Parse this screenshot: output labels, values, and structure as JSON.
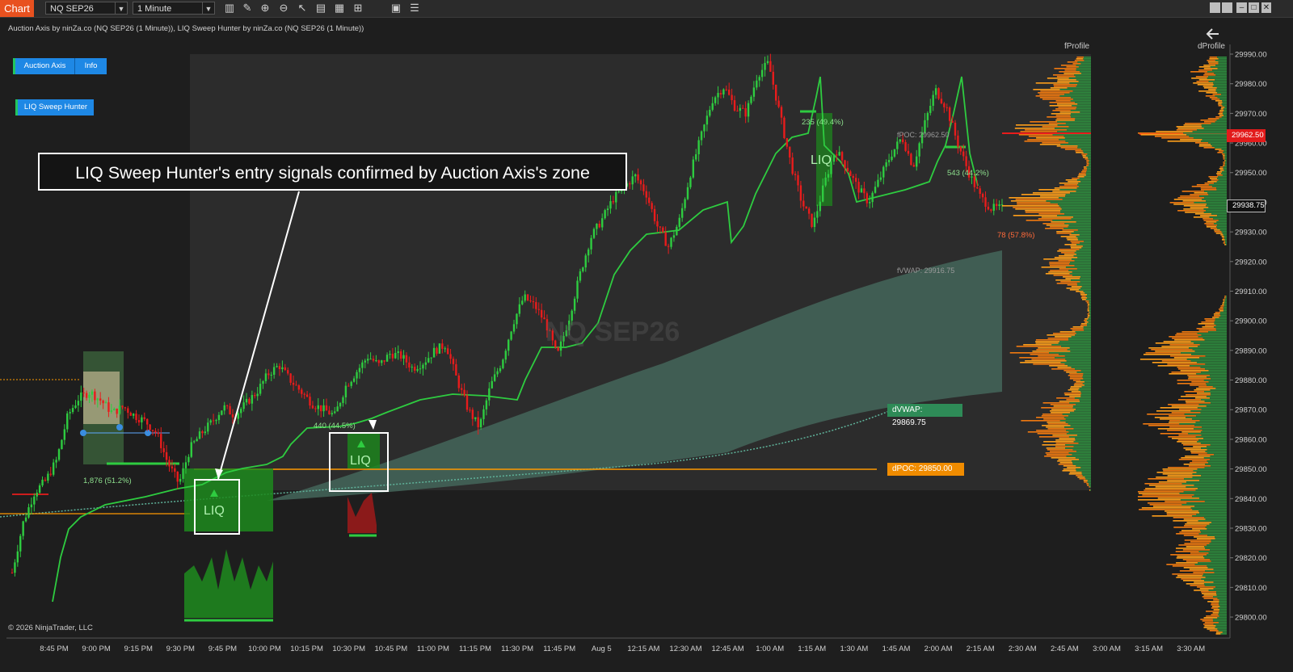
{
  "toolbar": {
    "tab_label": "Chart",
    "instrument": "NQ SEP26",
    "interval": "1 Minute",
    "icons": [
      "bar-type-icon",
      "draw-pencil-icon",
      "zoom-in-icon",
      "zoom-out-icon",
      "pointer-icon",
      "properties-icon",
      "templates-icon",
      "strategies-icon",
      "data-box-icon",
      "chart-trader-icon"
    ],
    "window_buttons": [
      "restore-icon",
      "maximize-icon",
      "minimize-icon",
      "tile-icon",
      "close-icon"
    ]
  },
  "indicator_title": "Auction Axis by ninZa.co (NQ SEP26 (1 Minute)), LIQ Sweep Hunter by ninZa.co (NQ SEP26 (1 Minute))",
  "panel_buttons": {
    "auction_axis": "Auction Axis",
    "info": "Info",
    "liq_sweep_hunter": "LIQ Sweep Hunter"
  },
  "profile_labels": {
    "fprofile": "fProfile",
    "dprofile": "dProfile"
  },
  "callout_text": "LIQ Sweep Hunter's entry signals confirmed by Auction Axis's zone",
  "watermark": "NQ SEP26",
  "copyright": "© 2026 NinjaTrader, LLC",
  "signals": {
    "liq_label": "LIQ"
  },
  "annotations": {
    "ann1": "1,876 (51.2%)",
    "ann2": "440 (44.5%)",
    "ann3": "235 (49.4%)",
    "ann4": "543 (44.2%)",
    "ann5": "78 (57.8%)",
    "fpoc": "fPOC: 29962.50",
    "fvwap": "fVWAP: 29916.75"
  },
  "tags": {
    "dvwap": "dVWAP: 29869.75",
    "dpoc": "dPOC: 29850.00",
    "price_red": "29962.50",
    "price_last": "29938.75"
  },
  "colors": {
    "bull": "#2ecc40",
    "bear": "#e81c1c",
    "vwap_band": "#4a6b5e",
    "dpoc_line": "#ff9900",
    "dvwap_tag": "#2e8b57",
    "dpoc_tag": "#f08c00",
    "profile_orange": "#ff9f1a",
    "profile_green": "#2e8b3e",
    "button_blue": "#1e88e5"
  },
  "chart_data": {
    "type": "candlestick",
    "y_axis": {
      "min": 29795,
      "max": 29992,
      "ticks": [
        29990,
        29980,
        29970,
        29960,
        29950,
        29940,
        29930,
        29920,
        29910,
        29900,
        29890,
        29880,
        29870,
        29860,
        29850,
        29840,
        29830,
        29820,
        29810,
        29800
      ]
    },
    "x_axis": {
      "ticks": [
        "8:45 PM",
        "9:00 PM",
        "9:15 PM",
        "9:30 PM",
        "9:45 PM",
        "10:00 PM",
        "10:15 PM",
        "10:30 PM",
        "10:45 PM",
        "11:00 PM",
        "11:15 PM",
        "11:30 PM",
        "11:45 PM",
        "Aug 5",
        "12:15 AM",
        "12:30 AM",
        "12:45 AM",
        "1:00 AM",
        "1:15 AM",
        "1:30 AM",
        "1:45 AM",
        "2:00 AM",
        "2:15 AM",
        "2:30 AM",
        "2:45 AM",
        "3:00 AM",
        "3:15 AM",
        "3:30 AM"
      ]
    },
    "price_path": [
      [
        0,
        29815
      ],
      [
        4,
        29832
      ],
      [
        8,
        29842
      ],
      [
        12,
        29846
      ],
      [
        16,
        29853
      ],
      [
        20,
        29868
      ],
      [
        24,
        29874
      ],
      [
        28,
        29876
      ],
      [
        32,
        29873
      ],
      [
        36,
        29869
      ],
      [
        40,
        29871
      ],
      [
        44,
        29868
      ],
      [
        48,
        29866
      ],
      [
        52,
        29862
      ],
      [
        56,
        29852
      ],
      [
        60,
        29845
      ],
      [
        64,
        29857
      ],
      [
        68,
        29862
      ],
      [
        72,
        29866
      ],
      [
        76,
        29871
      ],
      [
        80,
        29868
      ],
      [
        84,
        29872
      ],
      [
        88,
        29876
      ],
      [
        92,
        29882
      ],
      [
        96,
        29885
      ],
      [
        100,
        29880
      ],
      [
        104,
        29876
      ],
      [
        108,
        29872
      ],
      [
        112,
        29870
      ],
      [
        116,
        29868
      ],
      [
        120,
        29878
      ],
      [
        124,
        29883
      ],
      [
        128,
        29888
      ],
      [
        132,
        29885
      ],
      [
        136,
        29889
      ],
      [
        140,
        29888
      ],
      [
        144,
        29884
      ],
      [
        148,
        29886
      ],
      [
        152,
        29890
      ],
      [
        156,
        29892
      ],
      [
        160,
        29880
      ],
      [
        164,
        29870
      ],
      [
        168,
        29864
      ],
      [
        172,
        29878
      ],
      [
        176,
        29886
      ],
      [
        180,
        29899
      ],
      [
        184,
        29908
      ],
      [
        188,
        29905
      ],
      [
        192,
        29899
      ],
      [
        196,
        29888
      ],
      [
        200,
        29900
      ],
      [
        204,
        29915
      ],
      [
        208,
        29928
      ],
      [
        212,
        29934
      ],
      [
        216,
        29941
      ],
      [
        220,
        29945
      ],
      [
        224,
        29949
      ],
      [
        228,
        29943
      ],
      [
        232,
        29932
      ],
      [
        236,
        29925
      ],
      [
        240,
        29934
      ],
      [
        244,
        29950
      ],
      [
        248,
        29963
      ],
      [
        252,
        29975
      ],
      [
        256,
        29979
      ],
      [
        260,
        29972
      ],
      [
        264,
        29970
      ],
      [
        268,
        29983
      ],
      [
        272,
        29987
      ],
      [
        276,
        29970
      ],
      [
        280,
        29953
      ],
      [
        284,
        29940
      ],
      [
        288,
        29932
      ],
      [
        292,
        29946
      ],
      [
        296,
        29958
      ],
      [
        300,
        29952
      ],
      [
        304,
        29945
      ],
      [
        308,
        29940
      ],
      [
        312,
        29948
      ],
      [
        316,
        29956
      ],
      [
        320,
        29962
      ],
      [
        324,
        29952
      ],
      [
        328,
        29966
      ],
      [
        332,
        29978
      ],
      [
        336,
        29972
      ],
      [
        340,
        29960
      ],
      [
        344,
        29950
      ],
      [
        348,
        29942
      ],
      [
        352,
        29938
      ],
      [
        356,
        29938
      ]
    ],
    "volume_profiles": [
      "fProfile",
      "dProfile"
    ]
  }
}
